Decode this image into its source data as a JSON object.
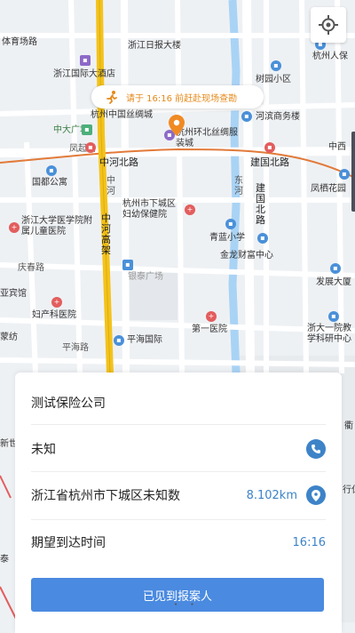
{
  "notice": {
    "text": "请于 16:16 前赶赴现场查勘"
  },
  "map_labels": {
    "l1": "体育场路",
    "l2": "浙江日报大楼",
    "l3": "浙江国际大酒店",
    "l4": "杭州人保",
    "l5": "树园小区",
    "l6": "杭州中国丝绸城",
    "l7": "中大广场",
    "l8": "河滨商务楼",
    "l9": "杭州环北丝绸服装城",
    "l10": "凤起路",
    "l11": "中河北路",
    "l12": "建国北路",
    "l13": "中西",
    "l14": "国都公寓",
    "l15": "凤栖花园",
    "l16": "中河",
    "l17": "杭州市下城区妇幼保健院",
    "l18": "东河",
    "l19": "建国北路",
    "l20": "浙江大学医学院附属儿童医院",
    "l21": "中河高架",
    "l22": "青蓝小学",
    "l23": "庆春路",
    "l24": "金龙财富中心",
    "l25": "发展大厦",
    "l26": "亚宾馆",
    "l27": "银泰广场",
    "l28": "妇产科医院",
    "l29": "第一医院",
    "l30": "浙大一院教学科研中心",
    "l31": "平海路",
    "l32": "平海国际",
    "l33": "蒙纺",
    "l34": "衢",
    "l35": "新世",
    "l36": "行仁",
    "l37": "泰"
  },
  "card": {
    "company": "测试保险公司",
    "contact": "未知",
    "address": "浙江省杭州市下城区未知数",
    "distance": "8.102km",
    "eta_label": "期望到达时间",
    "eta_value": "16:16",
    "button": "已见到报案人"
  },
  "colors": {
    "accent": "#3d83c8",
    "button": "#4a8ae0",
    "notice": "#e58a1a",
    "metro": "#e27a3a",
    "expressway": "#f3c31b"
  }
}
